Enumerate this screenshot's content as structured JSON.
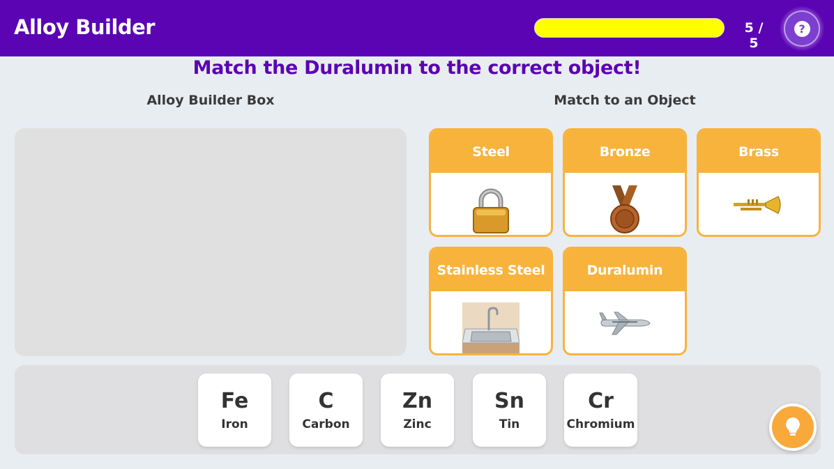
{
  "header": {
    "title": "Alloy Builder",
    "progress_fraction": 1.0,
    "progress_text": "5 / 5",
    "help_icon_glyph": "?"
  },
  "instruction": "Match the Duralumin to the correct object!",
  "builder": {
    "title": "Alloy Builder Box"
  },
  "objects": {
    "title": "Match to an Object",
    "cards": [
      {
        "label": "Steel",
        "icon": "padlock-icon"
      },
      {
        "label": "Bronze",
        "icon": "medal-icon"
      },
      {
        "label": "Brass",
        "icon": "trumpet-icon"
      },
      {
        "label": "Stainless Steel",
        "icon": "sink-icon"
      },
      {
        "label": "Duralumin",
        "icon": "airplane-icon"
      }
    ]
  },
  "elements": [
    {
      "symbol": "Fe",
      "name": "Iron"
    },
    {
      "symbol": "C",
      "name": "Carbon"
    },
    {
      "symbol": "Zn",
      "name": "Zinc"
    },
    {
      "symbol": "Sn",
      "name": "Tin"
    },
    {
      "symbol": "Cr",
      "name": "Chromium"
    }
  ],
  "hint": {
    "icon": "lightbulb-icon"
  },
  "colors": {
    "header_bg": "#5b04b4",
    "accent_orange": "#f8b33d",
    "progress_fill": "#ffff00",
    "instruction_text": "#5b04b4"
  }
}
